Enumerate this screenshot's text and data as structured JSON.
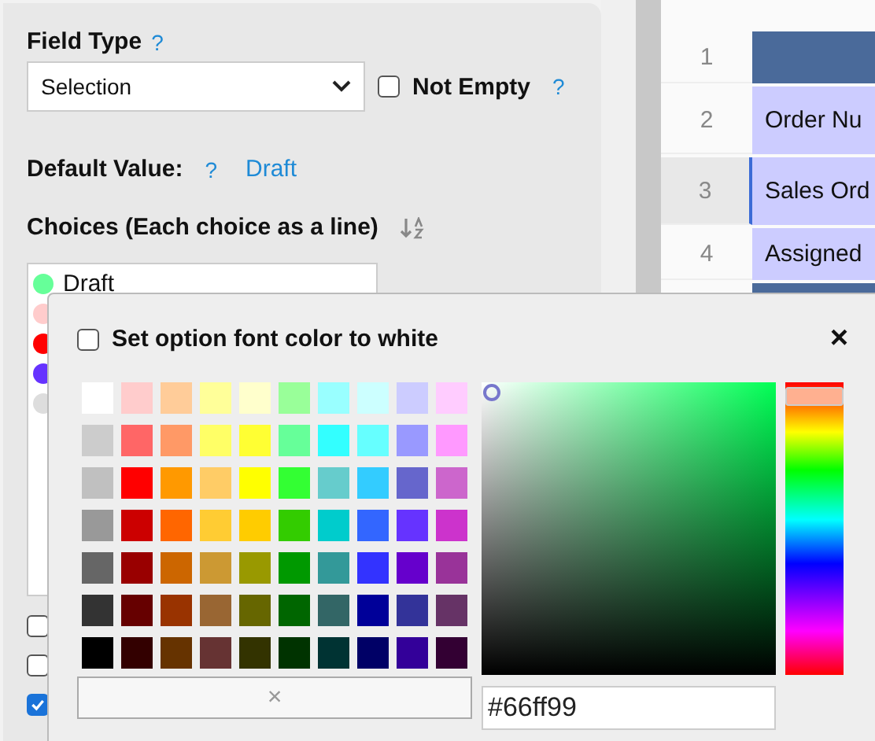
{
  "field_type": {
    "label": "Field Type",
    "help": "?",
    "value": "Selection"
  },
  "not_empty": {
    "label": "Not Empty",
    "checked": false,
    "help": "?"
  },
  "default_value": {
    "label": "Default Value:",
    "help": "?",
    "value": "Draft"
  },
  "choices": {
    "label": "Choices (Each choice as a line)",
    "items": [
      {
        "text": "Draft",
        "color": "#66ff99"
      },
      {
        "color": "#ffcccc"
      },
      {
        "color": "#ff0000"
      },
      {
        "color": "#6633ff"
      },
      {
        "color": "#dddddd"
      }
    ]
  },
  "option_checkboxes": [
    {
      "checked": false
    },
    {
      "checked": false
    },
    {
      "checked": true
    }
  ],
  "sheet": {
    "rows": [
      {
        "number": "1",
        "kind": "header",
        "selected": false
      },
      {
        "number": "2",
        "text": "Order Nu",
        "kind": "data",
        "selected": false
      },
      {
        "number": "3",
        "text": "Sales Ord",
        "kind": "data",
        "selected": true
      },
      {
        "number": "4",
        "text": "Assigned",
        "kind": "data",
        "selected": false
      },
      {
        "kind": "header"
      }
    ]
  },
  "color_popover": {
    "white_font": {
      "label": "Set option font color to white",
      "checked": false
    },
    "close": "×",
    "swatch_rows": [
      [
        {
          "color": "#ffffff"
        },
        {
          "color": "#ffcccc"
        },
        {
          "color": "#ffcc99"
        },
        {
          "color": "#ffff99"
        },
        {
          "color": "#ffffcc"
        },
        {
          "color": "#99ff99"
        },
        {
          "color": "#99ffff"
        },
        {
          "color": "#ccffff"
        },
        {
          "color": "#ccccff"
        },
        {
          "color": "#ffccff"
        }
      ],
      [
        {
          "color": "#cccccc"
        },
        {
          "color": "#ff6666"
        },
        {
          "color": "#ff9966"
        },
        {
          "color": "#ffff66"
        },
        {
          "color": "#ffff33"
        },
        {
          "color": "#66ff99"
        },
        {
          "color": "#33ffff"
        },
        {
          "color": "#66ffff"
        },
        {
          "color": "#9999ff"
        },
        {
          "color": "#ff99ff"
        }
      ],
      [
        {
          "color": "#c0c0c0"
        },
        {
          "color": "#ff0000"
        },
        {
          "color": "#ff9900"
        },
        {
          "color": "#ffcc66"
        },
        {
          "color": "#ffff00"
        },
        {
          "color": "#33ff33"
        },
        {
          "color": "#66cccc"
        },
        {
          "color": "#33ccff"
        },
        {
          "color": "#6666cc"
        },
        {
          "color": "#cc66cc"
        }
      ],
      [
        {
          "color": "#999999"
        },
        {
          "color": "#cc0000"
        },
        {
          "color": "#ff6600"
        },
        {
          "color": "#ffcc33"
        },
        {
          "color": "#ffcc00"
        },
        {
          "color": "#33cc00"
        },
        {
          "color": "#00cccc"
        },
        {
          "color": "#3366ff"
        },
        {
          "color": "#6633ff"
        },
        {
          "color": "#cc33cc"
        }
      ],
      [
        {
          "color": "#666666"
        },
        {
          "color": "#990000"
        },
        {
          "color": "#cc6600"
        },
        {
          "color": "#cc9933"
        },
        {
          "color": "#999900"
        },
        {
          "color": "#009900"
        },
        {
          "color": "#339999"
        },
        {
          "color": "#3333ff"
        },
        {
          "color": "#6600cc"
        },
        {
          "color": "#993399"
        }
      ],
      [
        {
          "color": "#333333"
        },
        {
          "color": "#660000"
        },
        {
          "color": "#993300"
        },
        {
          "color": "#996633"
        },
        {
          "color": "#666600"
        },
        {
          "color": "#006600"
        },
        {
          "color": "#336666"
        },
        {
          "color": "#000099"
        },
        {
          "color": "#333399"
        },
        {
          "color": "#663366"
        }
      ],
      [
        {
          "color": "#000000"
        },
        {
          "color": "#330000"
        },
        {
          "color": "#663300"
        },
        {
          "color": "#663333"
        },
        {
          "color": "#333300"
        },
        {
          "color": "#003300"
        },
        {
          "color": "#003333"
        },
        {
          "color": "#000066"
        },
        {
          "color": "#330099"
        },
        {
          "color": "#330033"
        }
      ]
    ],
    "clear": "×",
    "hue_slider": {
      "level": 0.02
    },
    "hex": "#66ff99"
  }
}
